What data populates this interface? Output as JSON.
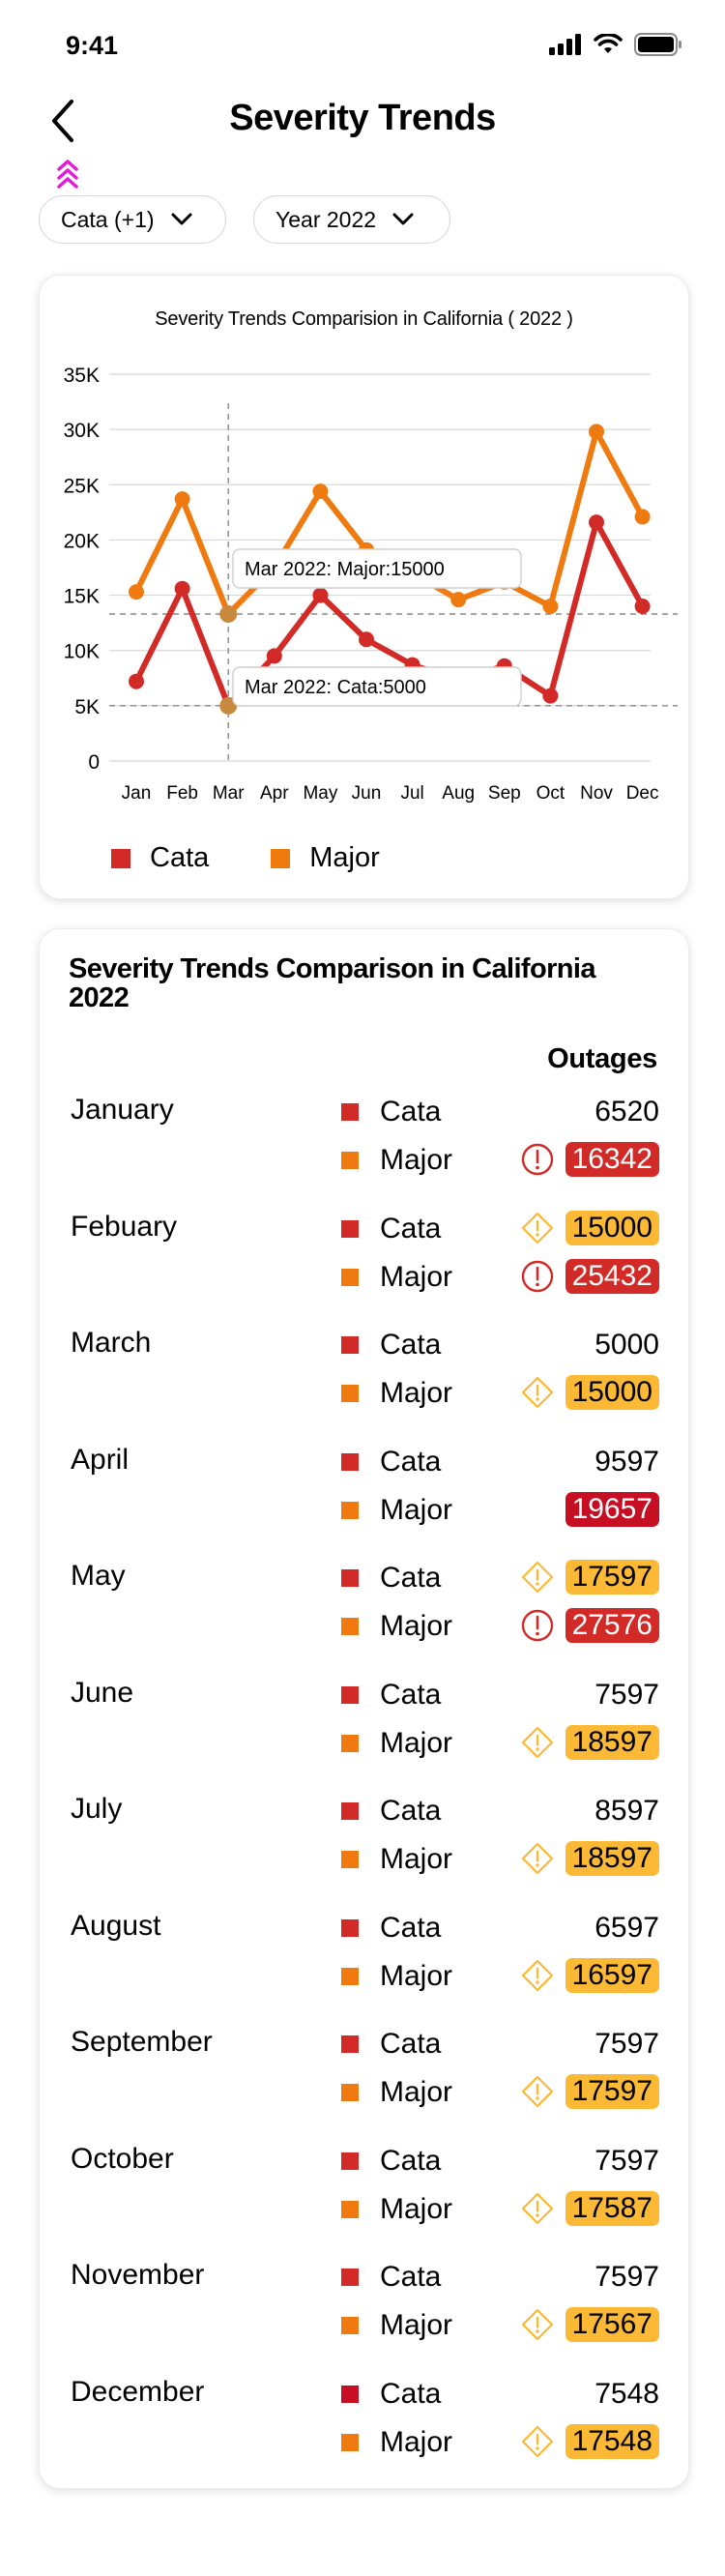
{
  "status": {
    "time": "9:41"
  },
  "header": {
    "title": "Severity Trends"
  },
  "filters": [
    {
      "label": "Cata (+1)"
    },
    {
      "label": "Year 2022"
    }
  ],
  "colors": {
    "cata": "#d22b27",
    "major": "#ef7b10",
    "alert_red": "#d22b27",
    "alert_yellow": "#fbb936"
  },
  "chart_data": {
    "type": "line",
    "title": "Severity  Trends Comparision in California ( 2022 )",
    "categories": [
      "Jan",
      "Feb",
      "Mar",
      "Apr",
      "May",
      "Jun",
      "Jul",
      "Aug",
      "Sep",
      "Oct",
      "Nov",
      "Dec"
    ],
    "series": [
      {
        "name": "Cata",
        "color": "#d22b27",
        "values": [
          7200,
          15600,
          5000,
          9500,
          15000,
          11000,
          8700,
          7300,
          8600,
          5900,
          21600,
          14000
        ]
      },
      {
        "name": "Major",
        "color": "#ef7b10",
        "values": [
          15300,
          23700,
          13300,
          17500,
          24400,
          19100,
          17000,
          14600,
          16200,
          14000,
          29800,
          22100
        ]
      }
    ],
    "y_ticks": [
      "0",
      "5K",
      "10K",
      "15K",
      "20K",
      "25K",
      "30K",
      "35K"
    ],
    "ylim": [
      0,
      35000
    ],
    "grid": true,
    "legend": "bottom",
    "tooltips": [
      "Mar 2022: Major:15000",
      "Mar 2022: Cata:5000"
    ]
  },
  "table": {
    "title": "Severity Trends Comparison in California 2022",
    "outages_header": "Outages",
    "months": [
      {
        "name": "January",
        "rows": [
          {
            "label": "Cata",
            "value": "6520",
            "status": "none"
          },
          {
            "label": "Major",
            "value": "16342",
            "status": "critical"
          }
        ]
      },
      {
        "name": "Febuary",
        "rows": [
          {
            "label": "Cata",
            "value": "15000",
            "status": "warning"
          },
          {
            "label": "Major",
            "value": "25432",
            "status": "critical"
          }
        ]
      },
      {
        "name": "March",
        "rows": [
          {
            "label": "Cata",
            "value": "5000",
            "status": "none"
          },
          {
            "label": "Major",
            "value": "15000",
            "status": "warning"
          }
        ]
      },
      {
        "name": "April",
        "rows": [
          {
            "label": "Cata",
            "value": "9597",
            "status": "none"
          },
          {
            "label": "Major",
            "value": "19657",
            "status": "severe"
          }
        ]
      },
      {
        "name": "May",
        "rows": [
          {
            "label": "Cata",
            "value": "17597",
            "status": "warning"
          },
          {
            "label": "Major",
            "value": "27576",
            "status": "critical"
          }
        ]
      },
      {
        "name": "June",
        "rows": [
          {
            "label": "Cata",
            "value": "7597",
            "status": "none"
          },
          {
            "label": "Major",
            "value": "18597",
            "status": "warning"
          }
        ]
      },
      {
        "name": "July",
        "rows": [
          {
            "label": "Cata",
            "value": "8597",
            "status": "none"
          },
          {
            "label": "Major",
            "value": "18597",
            "status": "warning"
          }
        ]
      },
      {
        "name": "August",
        "rows": [
          {
            "label": "Cata",
            "value": "6597",
            "status": "none"
          },
          {
            "label": "Major",
            "value": "16597",
            "status": "warning"
          }
        ]
      },
      {
        "name": "September",
        "rows": [
          {
            "label": "Cata",
            "value": "7597",
            "status": "none"
          },
          {
            "label": "Major",
            "value": "17597",
            "status": "warning"
          }
        ]
      },
      {
        "name": "October",
        "rows": [
          {
            "label": "Cata",
            "value": "7597",
            "status": "none"
          },
          {
            "label": "Major",
            "value": "17587",
            "status": "warning"
          }
        ]
      },
      {
        "name": "November",
        "rows": [
          {
            "label": "Cata",
            "value": "7597",
            "status": "none"
          },
          {
            "label": "Major",
            "value": "17567",
            "status": "warning"
          }
        ]
      },
      {
        "name": "December",
        "rows": [
          {
            "label": "Cata",
            "value": "7548",
            "status": "none"
          },
          {
            "label": "Major",
            "value": "17548",
            "status": "warning"
          }
        ]
      }
    ]
  }
}
